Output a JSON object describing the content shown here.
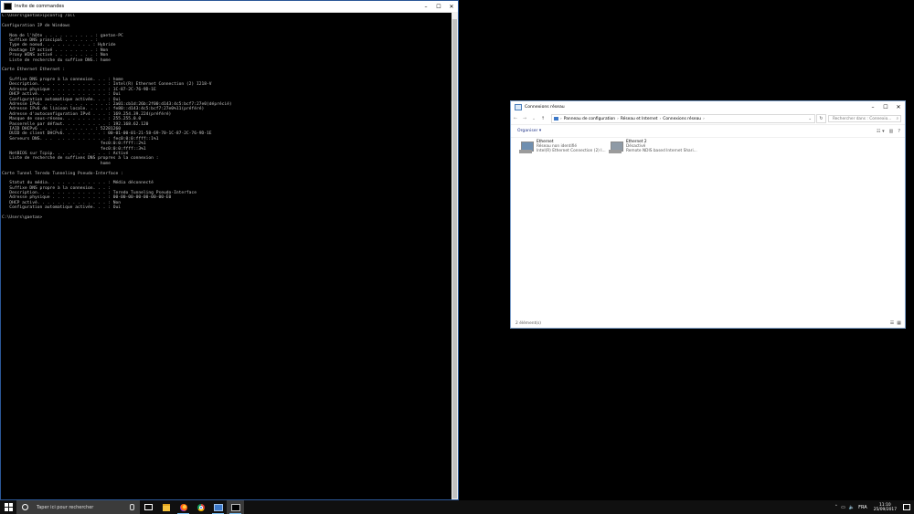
{
  "cmd": {
    "title": "Invite de commandes",
    "lines": [
      "C:\\Users\\gaetan>ipconfig /all",
      "",
      "Configuration IP de Windows",
      "",
      "   Nom de l'hôte . . . . . . . . . . : gaetan-PC",
      "   Suffixe DNS principal . . . . . . :",
      "   Type de noeud. . . . . . . . . . : Hybride",
      "   Routage IP activé . . . . . . . . : Non",
      "   Proxy WINS activé . . . . . . . . : Non",
      "   Liste de recherche du suffixe DNS.: home",
      "",
      "Carte Ethernet Ethernet :",
      "",
      "   Suffixe DNS propre à la connexion. . . : home",
      "   Description. . . . . . . . . . . . . . : Intel(R) Ethernet Connection (2) I218-V",
      "   Adresse physique . . . . . . . . . . . : 1C-87-2C-76-9D-1E",
      "   DHCP activé. . . . . . . . . . . . . . : Oui",
      "   Configuration automatique activée. . . : Oui",
      "   Adresse IPv6. . . . . . . . . . . . . .: 2a01:cb1d:26b:2f00:d143:4c5:bcf7:27e0(déprécié)",
      "   Adresse IPv6 de liaison locale. . . . .: fe80::d143:4c5:bcf7:27e0%11(préféré)",
      "   Adresse d'autoconfiguration IPv4 . . . : 169.254.39.224(préféré)",
      "   Masque de sous-réseau. . . . . . . . . : 255.255.0.0",
      "   Passerelle par défaut. . . . . . . . . : 192.168.62.120",
      "   IAID DHCPv6 . . . . . . . . . . . : 52281260",
      "   DUID de client DHCPv6. . . . . . . . : 00-01-00-01-21-58-69-70-1C-87-2C-76-9D-1E",
      "   Serveurs DNS. . .  . . . . . . . . . . : fec0:0:0:ffff::1%1",
      "                                       fec0:0:0:ffff::2%1",
      "                                       fec0:0:0:ffff::3%1",
      "   NetBIOS sur Tcpip. . . . . . . . . . . : Activé",
      "   Liste de recherche de suffixes DNS propres à la connexion :",
      "                                       home",
      "",
      "Carte Tunnel Teredo Tunneling Pseudo-Interface :",
      "",
      "   Statut du média. . . . . . . . . . . . : Média déconnecté",
      "   Suffixe DNS propre à la connexion. . . :",
      "   Description. . . . . . . . . . . . . . : Teredo Tunneling Pseudo-Interface",
      "   Adresse physique . . . . . . . . . . . : 00-00-00-00-00-00-00-E0",
      "   DHCP activé. . . . . . . . . . . . . . : Non",
      "   Configuration automatique activée. . . : Oui",
      "",
      "C:\\Users\\gaetan>"
    ]
  },
  "explorer": {
    "title": "Connexions réseau",
    "breadcrumb": [
      "Panneau de configuration",
      "Réseau et Internet",
      "Connexions réseau"
    ],
    "search_placeholder": "Rechercher dans : Connexio...",
    "organize_label": "Organiser ▾",
    "items": [
      {
        "name": "Ethernet",
        "status": "Réseau non identifié",
        "device": "Intel(R) Ethernet Connection (2) I..."
      },
      {
        "name": "Ethernet 2",
        "status": "Désactivé",
        "device": "Remote NDIS based Internet Shari..."
      }
    ],
    "status_text": "2 élément(s)"
  },
  "taskbar": {
    "search_placeholder": "Taper ici pour rechercher",
    "language": "FRA",
    "time": "11:10",
    "date": "25/09/2017"
  },
  "icons": [
    "windows-logo-icon",
    "search-icon",
    "microphone-icon",
    "task-view-icon",
    "folder-icon",
    "firefox-icon",
    "chrome-icon",
    "network-connections-icon",
    "cmd-icon",
    "network-adapter-icon"
  ]
}
